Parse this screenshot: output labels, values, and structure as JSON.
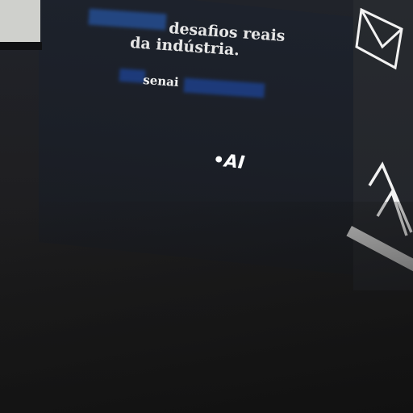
{
  "panel": {
    "headline_line1": "desafios reais",
    "headline_line2": "da indústria.",
    "brand_text": "senai",
    "logo_fragment": "•AI"
  },
  "icons": [
    "envelope-icon",
    "triangle-logo-icon"
  ],
  "colors": {
    "panel": "#1d222c",
    "text": "#e6e6e6",
    "accent_blue": "#2864c8"
  }
}
